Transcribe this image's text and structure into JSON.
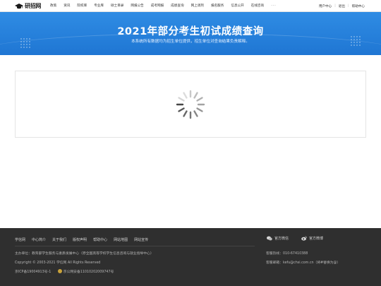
{
  "logo": {
    "text": "研招网"
  },
  "nav": {
    "items": [
      "政策",
      "资讯",
      "院校库",
      "专业库",
      "硕士目录",
      "网报公告",
      "成考网报",
      "成绩查询",
      "网上调剂",
      "报名服务",
      "信息公开",
      "在线咨询"
    ],
    "more": "···"
  },
  "user_links": {
    "user_center": "用户中心",
    "logout": "退出",
    "help": "帮助中心",
    "sep": "|"
  },
  "banner": {
    "title": "2021年部分考生初试成绩查询",
    "subtitle": "本系统所有数据均为招生单位提供，招生单位对查询结果负责解释。"
  },
  "footer": {
    "links": [
      "学信网",
      "中心简介",
      "关于我们",
      "版权声明",
      "帮助中心",
      "网站地图",
      "网站宣传"
    ],
    "sponsor": "主办单位：教育部学生服务与素质发展中心（原全国高等学校学生信息咨询与就业指导中心）",
    "copyright": "Copyright © 2003-2021 学信网 All Rights Reserved",
    "icp": "京ICP备19004913号-1",
    "police": "京公网安备11010202009747号",
    "wechat": "官方微信",
    "weibo": "官方微博",
    "hotline": "客服热线：010-67410388",
    "email": "客服邮箱：kefu@chsi.com.cn（将#替换为@）"
  }
}
